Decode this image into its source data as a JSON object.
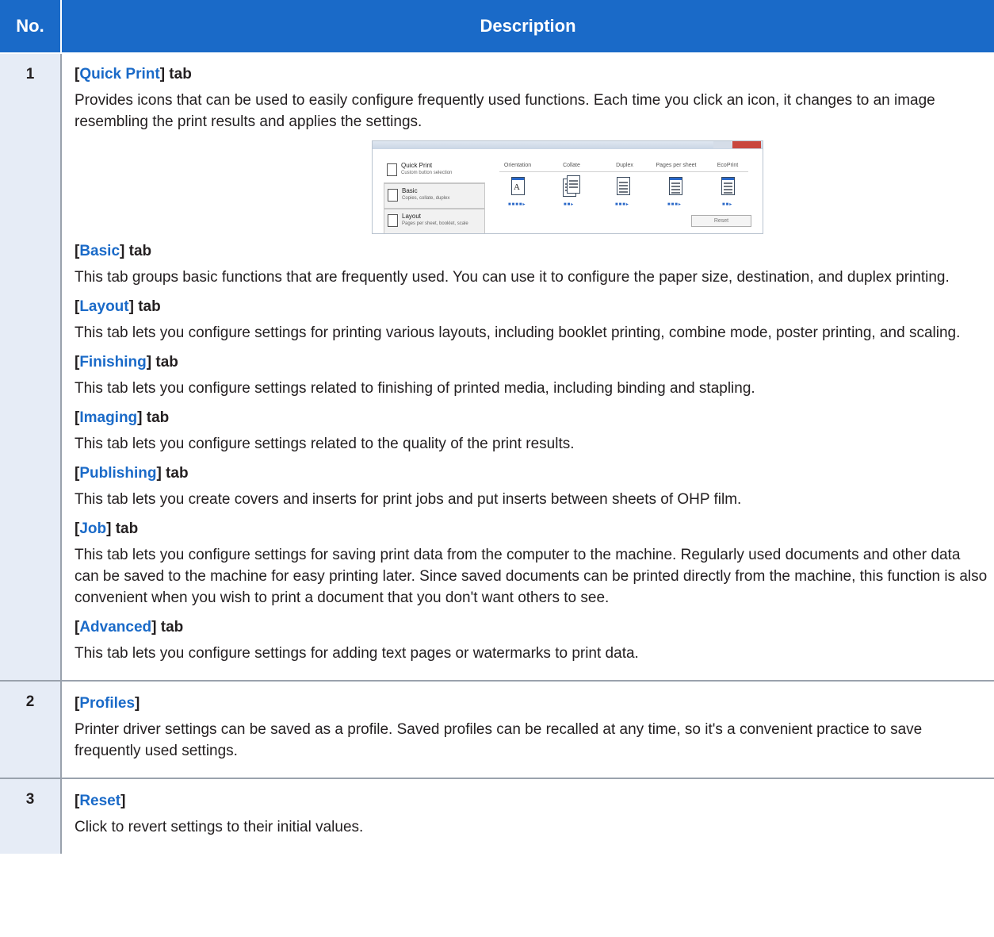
{
  "header": {
    "no": "No.",
    "description": "Description"
  },
  "rows": [
    {
      "no": "1",
      "items": [
        {
          "name": "Quick Print",
          "suffix": "] tab",
          "text": "Provides icons that can be used to easily configure frequently used functions. Each time you click an icon, it changes to an image resembling the print results and applies the settings."
        },
        {
          "name": "Basic",
          "suffix": "] tab",
          "text": "This tab groups basic functions that are frequently used. You can use it to configure the paper size, destination, and duplex printing."
        },
        {
          "name": "Layout",
          "suffix": "] tab",
          "text": "This tab lets you configure settings for printing various layouts, including booklet printing, combine mode, poster printing, and scaling."
        },
        {
          "name": "Finishing",
          "suffix": "] tab",
          "text": "This tab lets you configure settings related to finishing of printed media, including binding and stapling."
        },
        {
          "name": "Imaging",
          "suffix": "] tab",
          "text": "This tab lets you configure settings related to the quality of the print results."
        },
        {
          "name": "Publishing",
          "suffix": "] tab",
          "text": "This tab lets you create covers and inserts for print jobs and put inserts between sheets of OHP film."
        },
        {
          "name": "Job",
          "suffix": "] tab",
          "text": "This tab lets you configure settings for saving print data from the computer to the machine. Regularly used documents and other data can be saved to the machine for easy printing later. Since saved documents can be printed directly from the machine, this function is also convenient when you wish to print a document that you don't want others to see."
        },
        {
          "name": "Advanced",
          "suffix": "] tab",
          "text": "This tab lets you configure settings for adding text pages or watermarks to print data."
        }
      ]
    },
    {
      "no": "2",
      "items": [
        {
          "name": "Profiles",
          "suffix": "]",
          "text": "Printer driver settings can be saved as a profile. Saved profiles can be recalled at any time, so it's a convenient practice to save frequently used settings."
        }
      ]
    },
    {
      "no": "3",
      "items": [
        {
          "name": "Reset",
          "suffix": "]",
          "text": "Click to revert settings to their initial values."
        }
      ]
    }
  ],
  "screenshot": {
    "tabs": [
      {
        "title": "Quick Print",
        "subtitle": "Custom button selection"
      },
      {
        "title": "Basic",
        "subtitle": "Copies, collate, duplex"
      },
      {
        "title": "Layout",
        "subtitle": "Pages per sheet, booklet, scale"
      }
    ],
    "columns": [
      "Orientation",
      "Collate",
      "Duplex",
      "Pages per sheet",
      "EcoPrint"
    ],
    "orientation_glyph": "A",
    "reset_label": "Reset"
  },
  "colors": {
    "accent": "#1a6ac8",
    "number_column": "#e6ecf6"
  }
}
